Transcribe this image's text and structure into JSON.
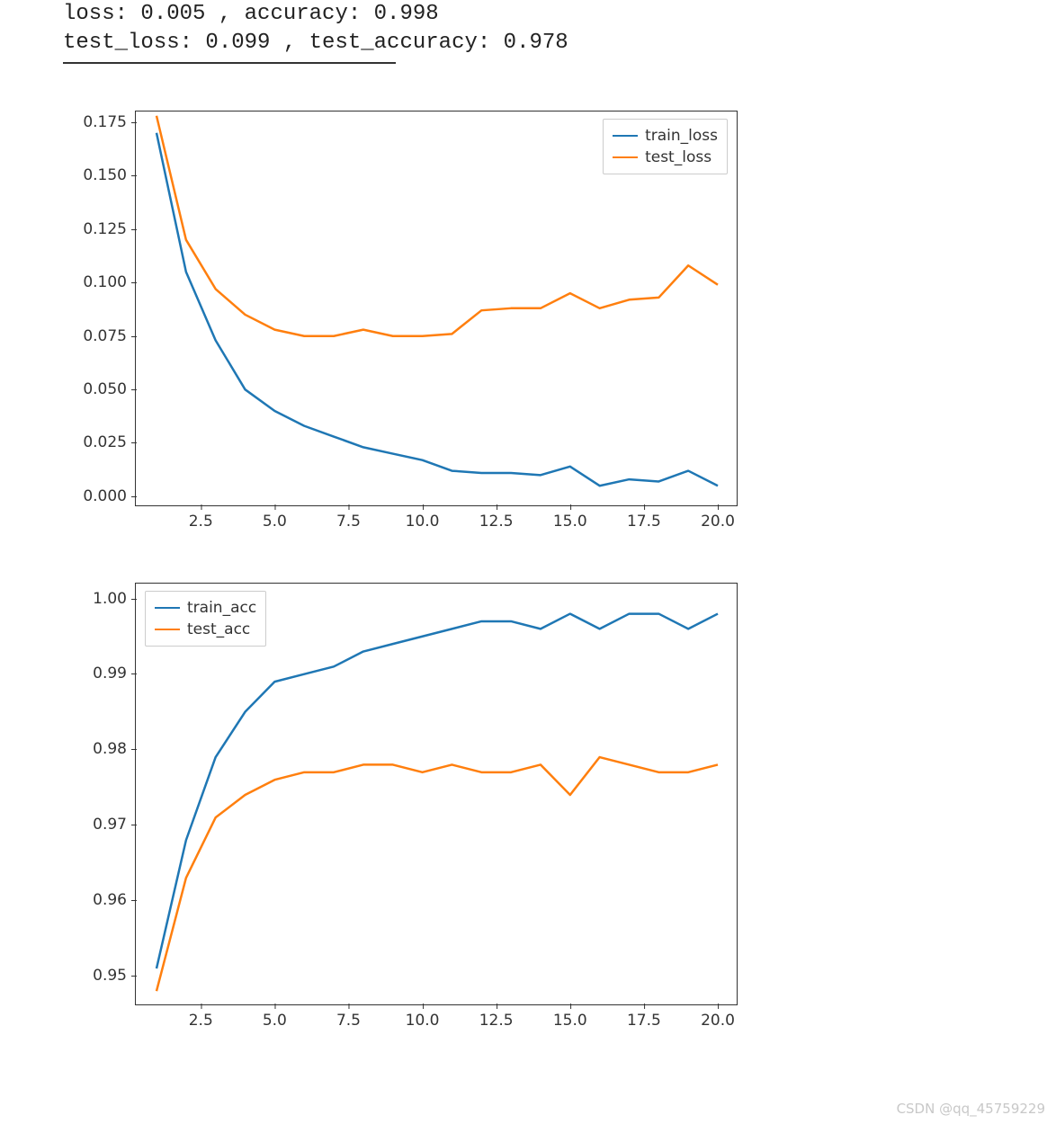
{
  "console": {
    "line1": "loss: 0.005 , accuracy: 0.998",
    "line2": "test_loss: 0.099 , test_accuracy: 0.978"
  },
  "watermark": "CSDN @qq_45759229",
  "colors": {
    "series1": "#1f77b4",
    "series2": "#ff7f0e"
  },
  "chart_data": [
    {
      "type": "line",
      "x": [
        1,
        2,
        3,
        4,
        5,
        6,
        7,
        8,
        9,
        10,
        11,
        12,
        13,
        14,
        15,
        16,
        17,
        18,
        19,
        20
      ],
      "series": [
        {
          "name": "train_loss",
          "values": [
            0.17,
            0.105,
            0.073,
            0.05,
            0.04,
            0.033,
            0.028,
            0.023,
            0.02,
            0.017,
            0.012,
            0.011,
            0.011,
            0.01,
            0.014,
            0.005,
            0.008,
            0.007,
            0.012,
            0.005
          ]
        },
        {
          "name": "test_loss",
          "values": [
            0.178,
            0.12,
            0.097,
            0.085,
            0.078,
            0.075,
            0.075,
            0.078,
            0.075,
            0.075,
            0.076,
            0.087,
            0.088,
            0.088,
            0.095,
            0.088,
            0.092,
            0.093,
            0.108,
            0.099
          ]
        }
      ],
      "xticks": [
        2.5,
        5.0,
        7.5,
        10.0,
        12.5,
        15.0,
        17.5,
        20.0
      ],
      "yticks": [
        0.0,
        0.025,
        0.05,
        0.075,
        0.1,
        0.125,
        0.15,
        0.175
      ],
      "ylim": [
        -0.005,
        0.18
      ],
      "xlim": [
        0.3,
        20.7
      ],
      "legend_pos": "top-right"
    },
    {
      "type": "line",
      "x": [
        1,
        2,
        3,
        4,
        5,
        6,
        7,
        8,
        9,
        10,
        11,
        12,
        13,
        14,
        15,
        16,
        17,
        18,
        19,
        20
      ],
      "series": [
        {
          "name": "train_acc",
          "values": [
            0.951,
            0.968,
            0.979,
            0.985,
            0.989,
            0.99,
            0.991,
            0.993,
            0.994,
            0.995,
            0.996,
            0.997,
            0.997,
            0.996,
            0.998,
            0.996,
            0.998,
            0.998,
            0.996,
            0.998
          ]
        },
        {
          "name": "test_acc",
          "values": [
            0.948,
            0.963,
            0.971,
            0.974,
            0.976,
            0.977,
            0.977,
            0.978,
            0.978,
            0.977,
            0.978,
            0.977,
            0.977,
            0.978,
            0.974,
            0.979,
            0.978,
            0.977,
            0.977,
            0.978
          ]
        }
      ],
      "xticks": [
        2.5,
        5.0,
        7.5,
        10.0,
        12.5,
        15.0,
        17.5,
        20.0
      ],
      "yticks": [
        0.95,
        0.96,
        0.97,
        0.98,
        0.99,
        1.0
      ],
      "ylim": [
        0.946,
        1.002
      ],
      "xlim": [
        0.3,
        20.7
      ],
      "legend_pos": "top-left"
    }
  ]
}
